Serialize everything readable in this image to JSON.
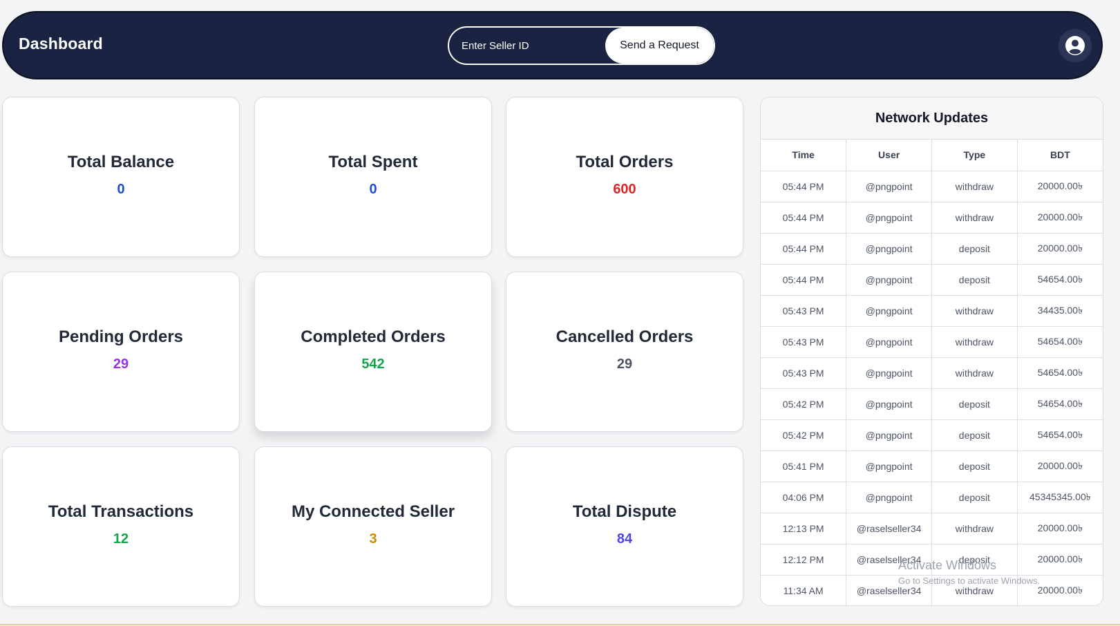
{
  "header": {
    "title": "Dashboard",
    "search_placeholder": "Enter Seller ID",
    "send_label": "Send a Request"
  },
  "stats": [
    {
      "label": "Total Balance",
      "value": "0",
      "color": "#1d4ed8"
    },
    {
      "label": "Total Spent",
      "value": "0",
      "color": "#1d4ed8"
    },
    {
      "label": "Total Orders",
      "value": "600",
      "color": "#dc2626"
    },
    {
      "label": "Pending Orders",
      "value": "29",
      "color": "#9333ea"
    },
    {
      "label": "Completed Orders",
      "value": "542",
      "color": "#16a34a"
    },
    {
      "label": "Cancelled Orders",
      "value": "29",
      "color": "#4b5563"
    },
    {
      "label": "Total Transactions",
      "value": "12",
      "color": "#16a34a"
    },
    {
      "label": "My Connected Seller",
      "value": "3",
      "color": "#ca8a04"
    },
    {
      "label": "Total Dispute",
      "value": "84",
      "color": "#4f46e5"
    }
  ],
  "network": {
    "title": "Network Updates",
    "columns": [
      "Time",
      "User",
      "Type",
      "BDT"
    ],
    "rows": [
      [
        "05:44 PM",
        "@pngpoint",
        "withdraw",
        "20000.00৳"
      ],
      [
        "05:44 PM",
        "@pngpoint",
        "withdraw",
        "20000.00৳"
      ],
      [
        "05:44 PM",
        "@pngpoint",
        "deposit",
        "20000.00৳"
      ],
      [
        "05:44 PM",
        "@pngpoint",
        "deposit",
        "54654.00৳"
      ],
      [
        "05:43 PM",
        "@pngpoint",
        "withdraw",
        "34435.00৳"
      ],
      [
        "05:43 PM",
        "@pngpoint",
        "withdraw",
        "54654.00৳"
      ],
      [
        "05:43 PM",
        "@pngpoint",
        "withdraw",
        "54654.00৳"
      ],
      [
        "05:42 PM",
        "@pngpoint",
        "deposit",
        "54654.00৳"
      ],
      [
        "05:42 PM",
        "@pngpoint",
        "deposit",
        "54654.00৳"
      ],
      [
        "05:41 PM",
        "@pngpoint",
        "deposit",
        "20000.00৳"
      ],
      [
        "04:06 PM",
        "@pngpoint",
        "deposit",
        "45345345.00৳"
      ],
      [
        "12:13 PM",
        "@raselseller34",
        "withdraw",
        "20000.00৳"
      ],
      [
        "12:12 PM",
        "@raselseller34",
        "deposit",
        "20000.00৳"
      ],
      [
        "11:34 AM",
        "@raselseller34",
        "withdraw",
        "20000.00৳"
      ]
    ]
  },
  "watermark": {
    "line1": "Activate Windows",
    "line2": "Go to Settings to activate Windows."
  },
  "icons": {
    "avatar": "user-circle-icon"
  }
}
